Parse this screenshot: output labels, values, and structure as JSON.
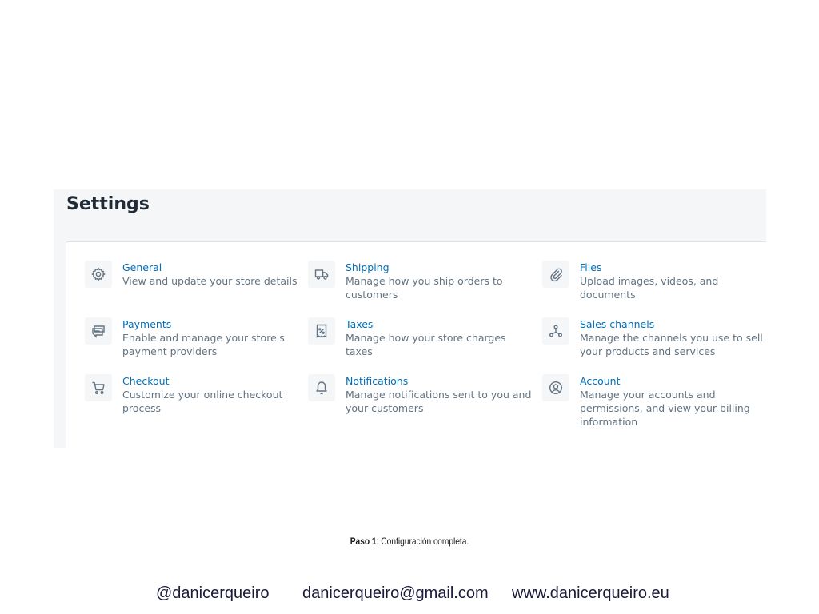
{
  "settings": {
    "title": "Settings",
    "items": [
      {
        "icon": "gear-icon",
        "title": "General",
        "desc": "View and update your store details"
      },
      {
        "icon": "truck-icon",
        "title": "Shipping",
        "desc": "Manage how you ship orders to\ncustomers"
      },
      {
        "icon": "paperclip-icon",
        "title": "Files",
        "desc": "Upload images, videos, and\ndocuments"
      },
      {
        "icon": "payments-icon",
        "title": "Payments",
        "desc": "Enable and manage your store's\npayment providers"
      },
      {
        "icon": "receipt-percent-icon",
        "title": "Taxes",
        "desc": "Manage how your store charges\ntaxes"
      },
      {
        "icon": "sales-channels-icon",
        "title": "Sales channels",
        "desc": "Manage the channels you use to sell\nyour products and services"
      },
      {
        "icon": "cart-icon",
        "title": "Checkout",
        "desc": "Customize your online checkout\nprocess"
      },
      {
        "icon": "bell-icon",
        "title": "Notifications",
        "desc": "Manage notifications sent to you and\nyour customers"
      },
      {
        "icon": "user-circle-icon",
        "title": "Account",
        "desc": "Manage your accounts and\npermissions, and view your billing\ninformation"
      }
    ]
  },
  "caption": {
    "step": "Paso 1",
    "text": ": Configuración completa."
  },
  "footer": {
    "handle": "@danicerqueiro",
    "email": "danicerqueiro@gmail.com",
    "website": "www.danicerqueiro.eu"
  },
  "colors": {
    "link": "#006fbb",
    "muted": "#637381",
    "heading": "#212b36",
    "page_bg": "#f4f6f8"
  }
}
